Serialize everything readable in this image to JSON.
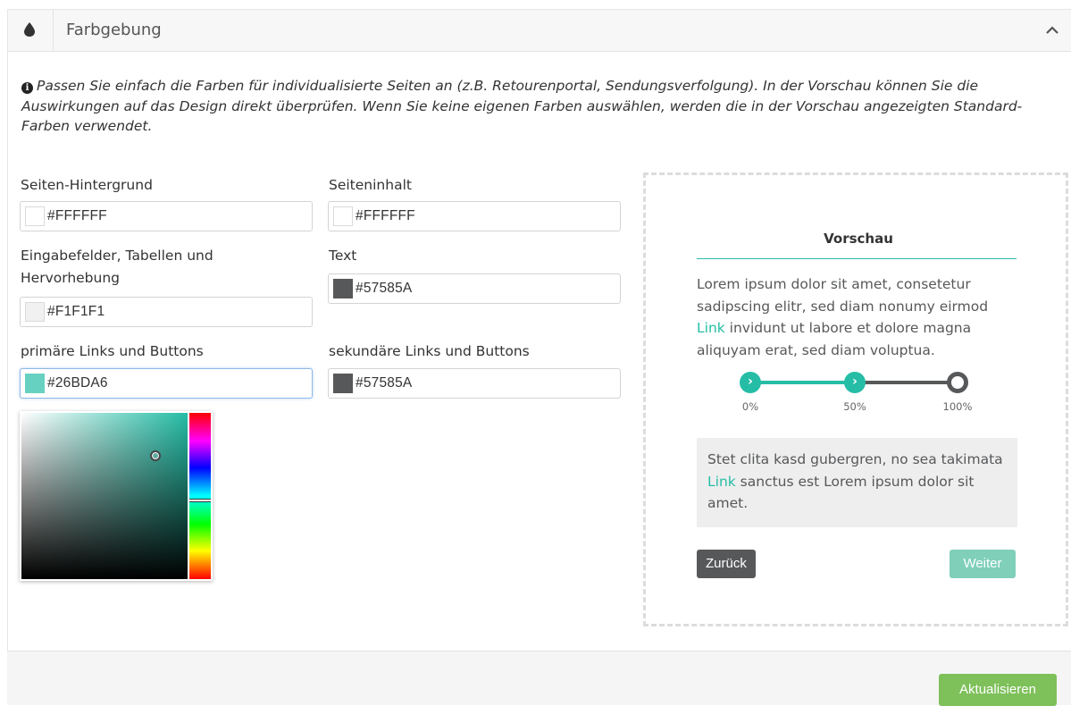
{
  "header": {
    "title": "Farbgebung"
  },
  "info_text": "Passen Sie einfach die Farben für individualisierte Seiten an (z.B. Retourenportal, Sendungsverfolgung). In der Vorschau können Sie die Auswirkungen auf das Design direkt überprüfen. Wenn Sie keine eigenen Farben auswählen, werden die in der Vorschau angezeigten Standard-Farben verwendet.",
  "fields": {
    "page_background": {
      "label": "Seiten-Hintergrund",
      "value": "#FFFFFF"
    },
    "page_content": {
      "label": "Seiteninhalt",
      "value": "#FFFFFF"
    },
    "inputs_tables": {
      "label_line1": "Eingabefelder, Tabellen und",
      "label_line2": "Hervorhebung",
      "value": "#F1F1F1"
    },
    "text": {
      "label": "Text",
      "value": "#57585A"
    },
    "primary_links": {
      "label": "primäre Links und Buttons",
      "value": "#26BDA6"
    },
    "secondary_links": {
      "label": "sekundäre Links und Buttons",
      "value": "#57585A"
    }
  },
  "preview": {
    "title": "Vorschau",
    "text_before_link": "Lorem ipsum dolor sit amet, consetetur sadipscing elitr, sed diam nonumy eirmod ",
    "link": "Link",
    "text_after_link": " invidunt ut labore et dolore magna aliquyam erat, sed diam voluptua.",
    "progress_labels": [
      "0%",
      "50%",
      "100%"
    ],
    "box_text_before_link": "Stet clita kasd gubergren, no sea takimata ",
    "box_link": "Link",
    "box_text_after_link": " sanctus est Lorem ipsum dolor sit amet.",
    "back_button": "Zurück",
    "next_button": "Weiter"
  },
  "footer": {
    "update_button": "Aktualisieren"
  },
  "colors": {
    "primary": "#26BDA6",
    "text": "#57585A",
    "highlight": "#F1F1F1",
    "update_button": "#7EC05A"
  }
}
